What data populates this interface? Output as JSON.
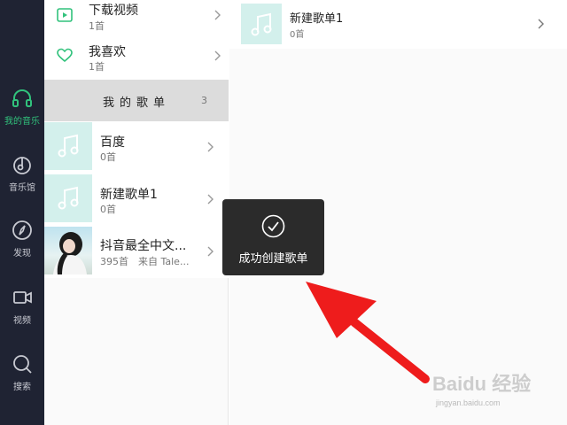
{
  "nav": {
    "items": [
      {
        "label": "我的音乐",
        "icon": "headphones-icon",
        "active": true
      },
      {
        "label": "音乐馆",
        "icon": "music-note-circle-icon",
        "active": false
      },
      {
        "label": "发现",
        "icon": "compass-icon",
        "active": false
      },
      {
        "label": "视频",
        "icon": "video-camera-icon",
        "active": false
      },
      {
        "label": "搜索",
        "icon": "search-icon",
        "active": false
      }
    ],
    "active_color": "#31c27c"
  },
  "library": {
    "items": [
      {
        "title": "下载视频",
        "count": "1首",
        "icon": "play-video-icon"
      },
      {
        "title": "我喜欢",
        "count": "1首",
        "icon": "heart-icon"
      }
    ]
  },
  "playlists": {
    "header": "我的歌单",
    "count": "3",
    "items": [
      {
        "title": "百度",
        "sub": "0首"
      },
      {
        "title": "新建歌单1",
        "sub": "0首"
      },
      {
        "title": "抖音最全中文...",
        "sub": "395首　来自 Tale..."
      }
    ]
  },
  "detail": {
    "title": "新建歌单1",
    "sub": "0首"
  },
  "toast": {
    "message": "成功创建歌单",
    "icon": "checkmark-circle-icon"
  },
  "watermark": {
    "logo": "Baidu 经验",
    "url": "jingyan.baidu.com"
  }
}
